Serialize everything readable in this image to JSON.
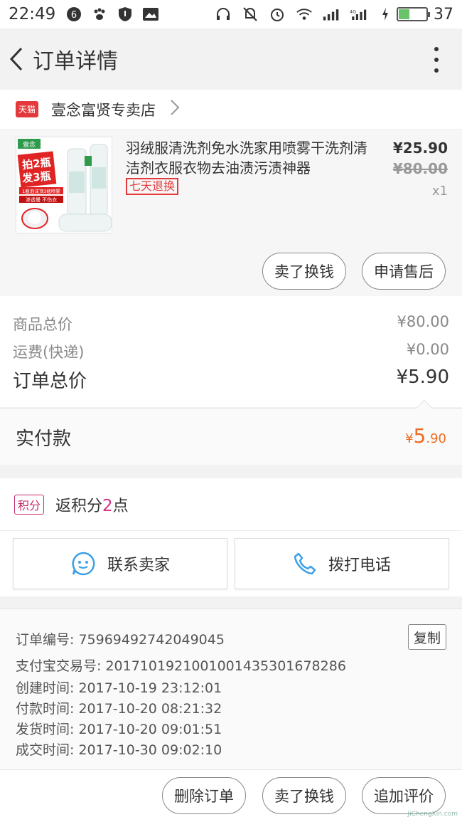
{
  "status_bar": {
    "time": "22:49",
    "battery": "37",
    "battery_fraction": 0.37
  },
  "nav": {
    "title": "订单详情"
  },
  "store": {
    "badge": "天猫",
    "name": "壹念富贤专卖店"
  },
  "product": {
    "title": "羽绒服清洗剂免水洗家用喷雾干洗剂清洁剂衣服衣物去油渍污渍神器",
    "return_tag": "七天退换",
    "price": "¥25.90",
    "original_price": "¥80.00",
    "quantity": "x1",
    "image_text": {
      "brand": "壹念",
      "promo_line1": "拍2瓶",
      "promo_line2": "发3瓶",
      "tagline1": "1瓶泡沫顶3瓶喷雾",
      "tagline2": "渗透慢 不伤衣"
    },
    "buttons": {
      "sell": "卖了换钱",
      "after_sale": "申请售后"
    }
  },
  "summary": {
    "goods_label": "商品总价",
    "goods_value": "¥80.00",
    "shipping_label": "运费(快递)",
    "shipping_value": "¥0.00",
    "total_label": "订单总价",
    "total_value": "¥5.90",
    "paid_label": "实付款",
    "paid_currency": "¥",
    "paid_int": "5",
    "paid_dec": ".90"
  },
  "points": {
    "badge": "积分",
    "text_prefix": "返积分",
    "number": "2",
    "text_suffix": "点"
  },
  "contact": {
    "seller": "联系卖家",
    "phone": "拨打电话"
  },
  "order_info": {
    "order_no": "订单编号: 75969492742049045",
    "copy": "复制",
    "alipay_no": "支付宝交易号: 2017101921001001435301678286",
    "created": "创建时间: 2017-10-19 23:12:01",
    "paid": "付款时间: 2017-10-20 08:21:32",
    "shipped": "发货时间: 2017-10-20 09:01:51",
    "closed": "成交时间: 2017-10-30 09:02:10"
  },
  "bottom_bar": {
    "delete": "删除订单",
    "sell": "卖了换钱",
    "review": "追加评价"
  },
  "watermark": "JiChengXin.com",
  "colors": {
    "tmall_red": "#e4393c",
    "paid_orange": "#ef6b22",
    "points_pink": "#d63384",
    "seller_blue": "#3aa0e8"
  }
}
